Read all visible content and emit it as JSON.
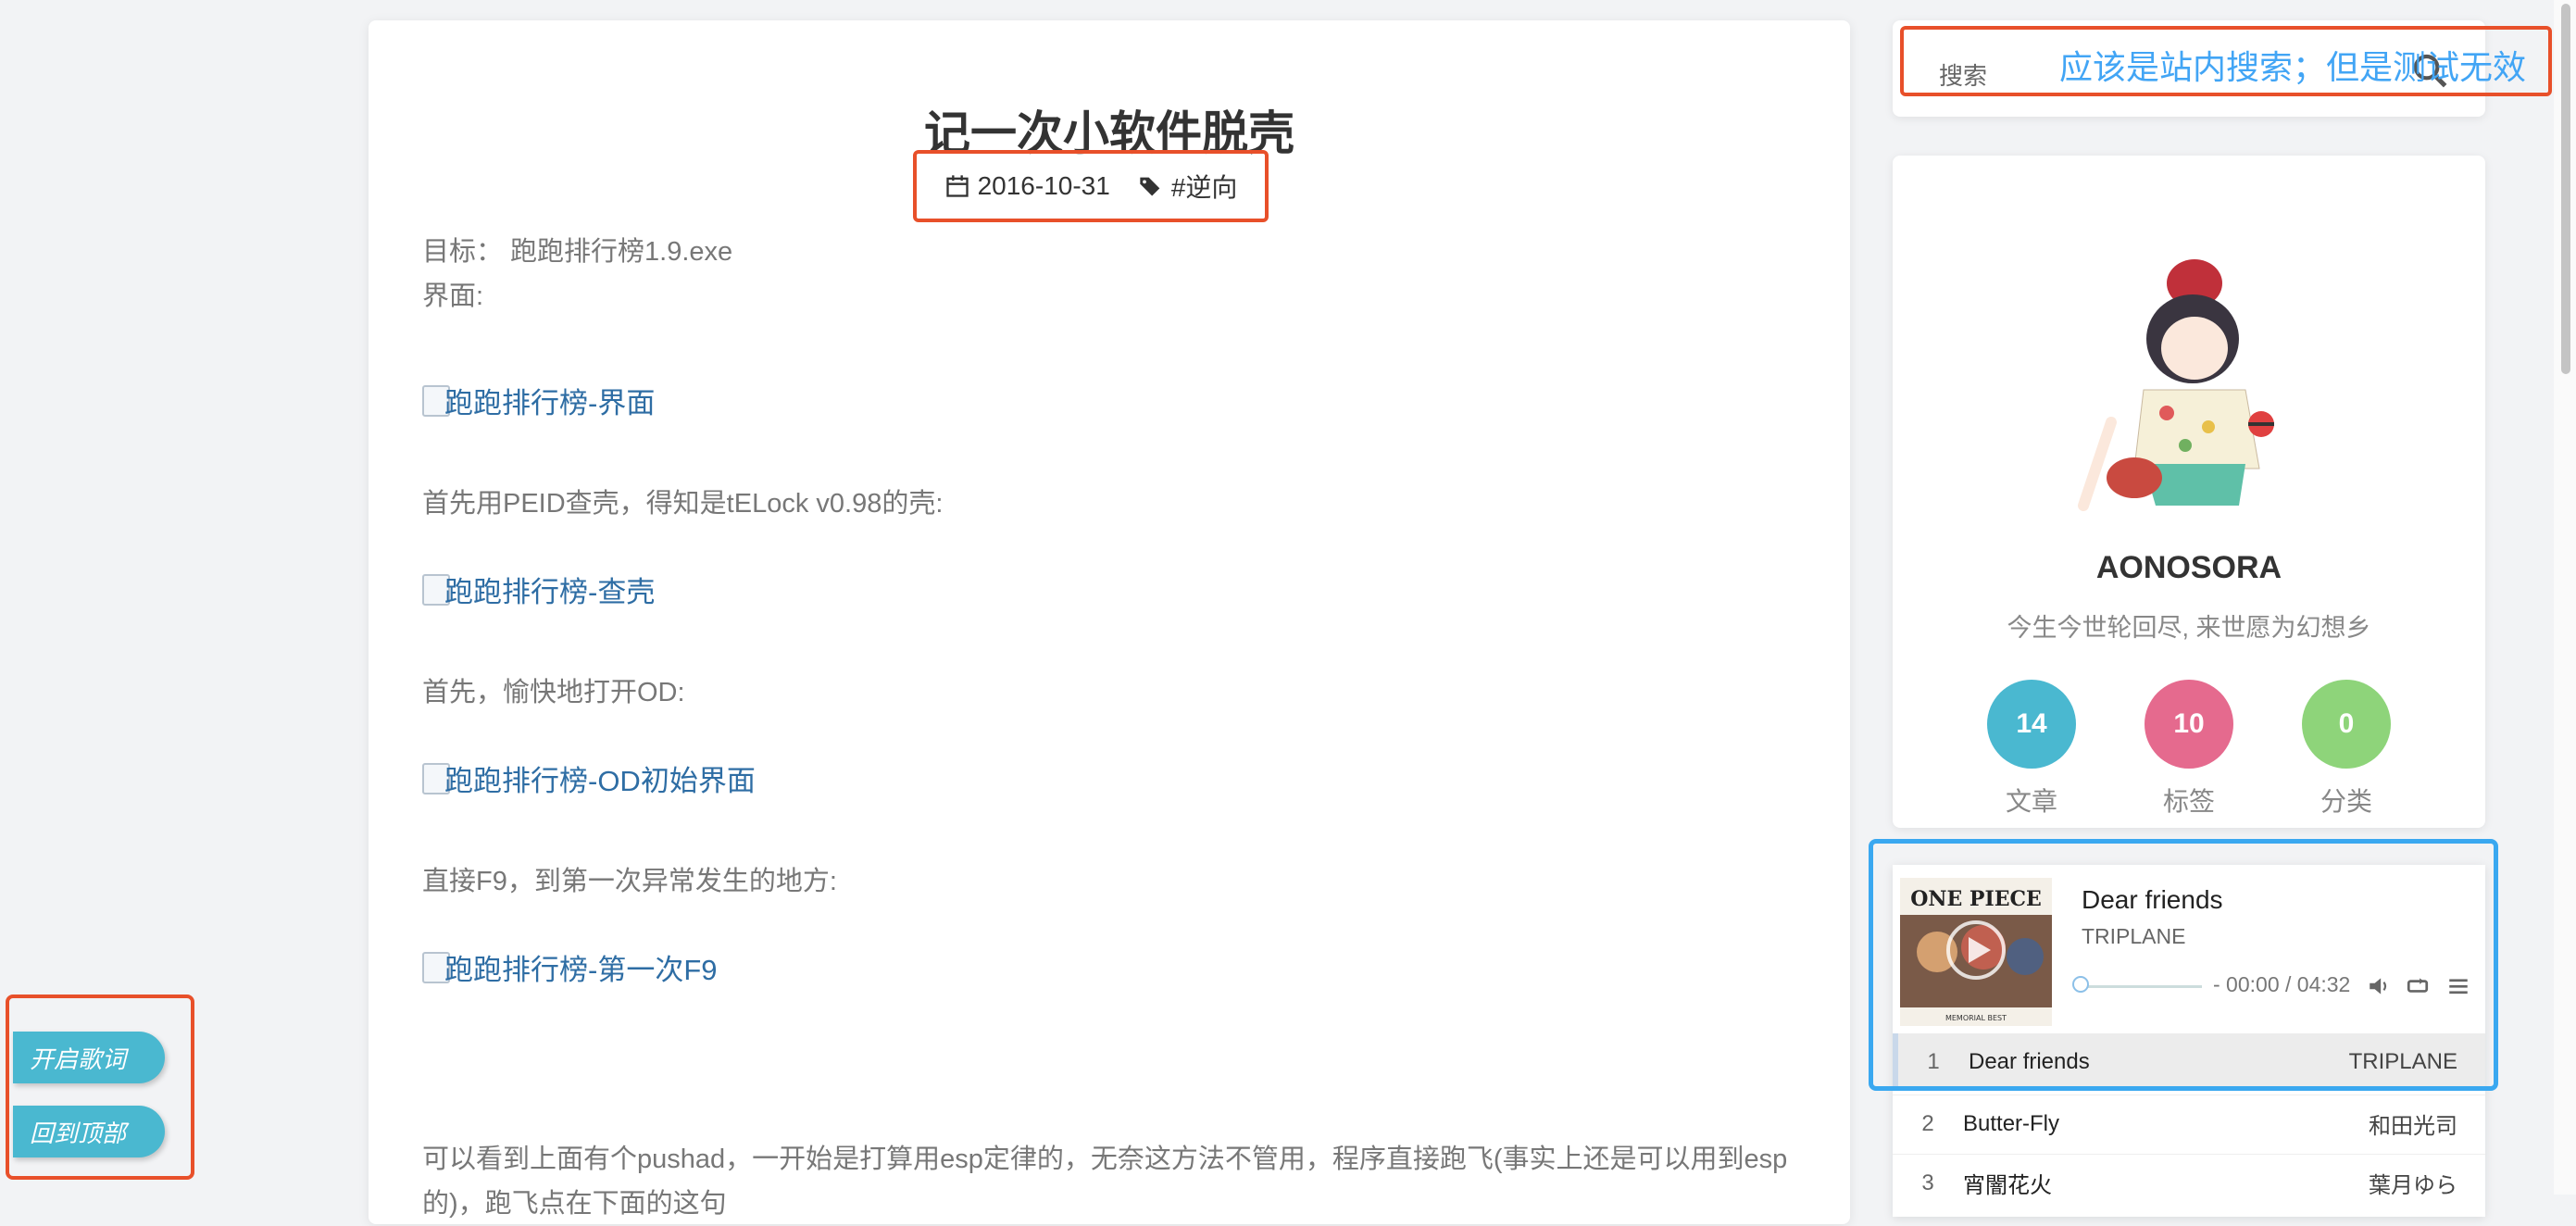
{
  "article": {
    "title": "记一次小软件脱壳",
    "date": "2016-10-31",
    "tag": "#逆向",
    "paragraphs": [
      "目标： 跑跑排行榜1.9.exe",
      "界面:",
      "首先用PEID查壳，得知是tELock v0.98的壳:",
      "首先，愉快地打开OD:",
      "直接F9，到第一次异常发生的地方:",
      "可以看到上面有个pushad，一开始是打算用esp定律的，无奈这方法不管用，程序直接跑飞(事实上还是可以用到esp的)，跑飞点在下面的这句"
    ],
    "images": [
      "跑跑排行榜-界面",
      "跑跑排行榜-查壳",
      "跑跑排行榜-OD初始界面",
      "跑跑排行榜-第一次F9"
    ]
  },
  "search": {
    "placeholder": "搜索",
    "annotation": "应该是站内搜索；但是测试无效"
  },
  "profile": {
    "name": "AONOSORA",
    "motto": "今生今世轮回尽, 来世愿为幻想乡",
    "stats": [
      {
        "value": "14",
        "label": "文章",
        "color": "#4ab8d0"
      },
      {
        "value": "10",
        "label": "标签",
        "color": "#e56a8e"
      },
      {
        "value": "0",
        "label": "分类",
        "color": "#8ed47a"
      }
    ]
  },
  "player": {
    "title": "Dear friends",
    "artist": "TRIPLANE",
    "time": "- 00:00 / 04:32",
    "cover_text": "ONE PIECE",
    "cover_sub": "MEMORIAL BEST",
    "playlist": [
      {
        "num": "1",
        "title": "Dear friends",
        "artist": "TRIPLANE"
      },
      {
        "num": "2",
        "title": "Butter-Fly",
        "artist": "和田光司"
      },
      {
        "num": "3",
        "title": "宵闇花火",
        "artist": "葉月ゆら"
      }
    ]
  },
  "floating": {
    "lyrics_label": "开启歌词",
    "top_label": "回到顶部"
  }
}
